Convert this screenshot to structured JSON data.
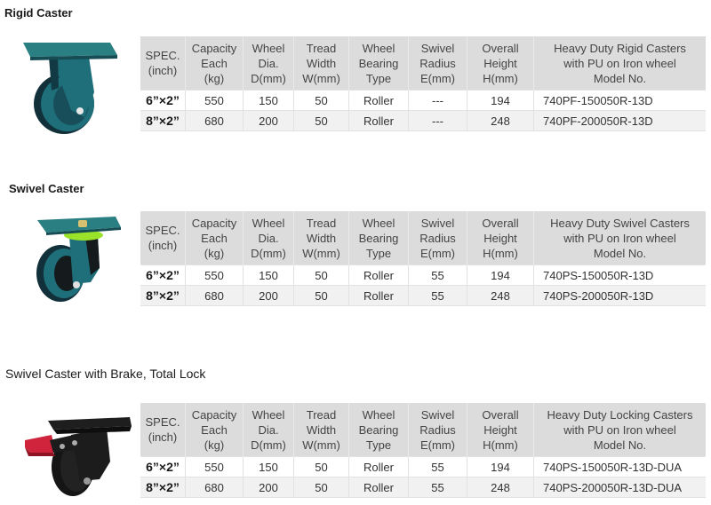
{
  "columns": [
    "SPEC.\n(inch)",
    "Capacity\nEach\n(kg)",
    "Wheel\nDia.\nD(mm)",
    "Tread\nWidth\nW(mm)",
    "Wheel\nBearing\nType",
    "Swivel\nRadius\nE(mm)",
    "Overall\nHeight\nH(mm)"
  ],
  "sections": [
    {
      "title": "Rigid Caster",
      "image_icon": "rigid-caster-image",
      "model_header": "Heavy Duty Rigid Casters\nwith PU on Iron wheel\nModel No.",
      "rows": [
        {
          "spec": "6”×2”",
          "capacity": "550",
          "wheel_dia": "150",
          "tread": "50",
          "bearing": "Roller",
          "swivel": "---",
          "height": "194",
          "model": "740PF-150050R-13D"
        },
        {
          "spec": "8”×2”",
          "capacity": "680",
          "wheel_dia": "200",
          "tread": "50",
          "bearing": "Roller",
          "swivel": "---",
          "height": "248",
          "model": "740PF-200050R-13D"
        }
      ]
    },
    {
      "title": "Swivel Caster",
      "image_icon": "swivel-caster-image",
      "model_header": "Heavy Duty Swivel Casters\nwith PU on Iron wheel\nModel No.",
      "rows": [
        {
          "spec": "6”×2”",
          "capacity": "550",
          "wheel_dia": "150",
          "tread": "50",
          "bearing": "Roller",
          "swivel": "55",
          "height": "194",
          "model": "740PS-150050R-13D"
        },
        {
          "spec": "8”×2”",
          "capacity": "680",
          "wheel_dia": "200",
          "tread": "50",
          "bearing": "Roller",
          "swivel": "55",
          "height": "248",
          "model": "740PS-200050R-13D"
        }
      ]
    },
    {
      "title": "Swivel Caster with Brake, Total Lock",
      "image_icon": "locking-caster-image",
      "model_header": "Heavy Duty Locking Casters\nwith PU on Iron wheel\nModel No.",
      "rows": [
        {
          "spec": "6”×2”",
          "capacity": "550",
          "wheel_dia": "150",
          "tread": "50",
          "bearing": "Roller",
          "swivel": "55",
          "height": "194",
          "model": "740PS-150050R-13D-DUA"
        },
        {
          "spec": "8”×2”",
          "capacity": "680",
          "wheel_dia": "200",
          "tread": "50",
          "bearing": "Roller",
          "swivel": "55",
          "height": "248",
          "model": "740PS-200050R-13D-DUA"
        }
      ]
    }
  ],
  "colors": {
    "header_bg": "#dcdcdc",
    "row_alt_bg": "#f1f1f1",
    "caster_teal": "#1f6f7a",
    "caster_black": "#1c1c1c",
    "swivel_ring_green": "#9be22a",
    "brake_red": "#d0243c"
  }
}
